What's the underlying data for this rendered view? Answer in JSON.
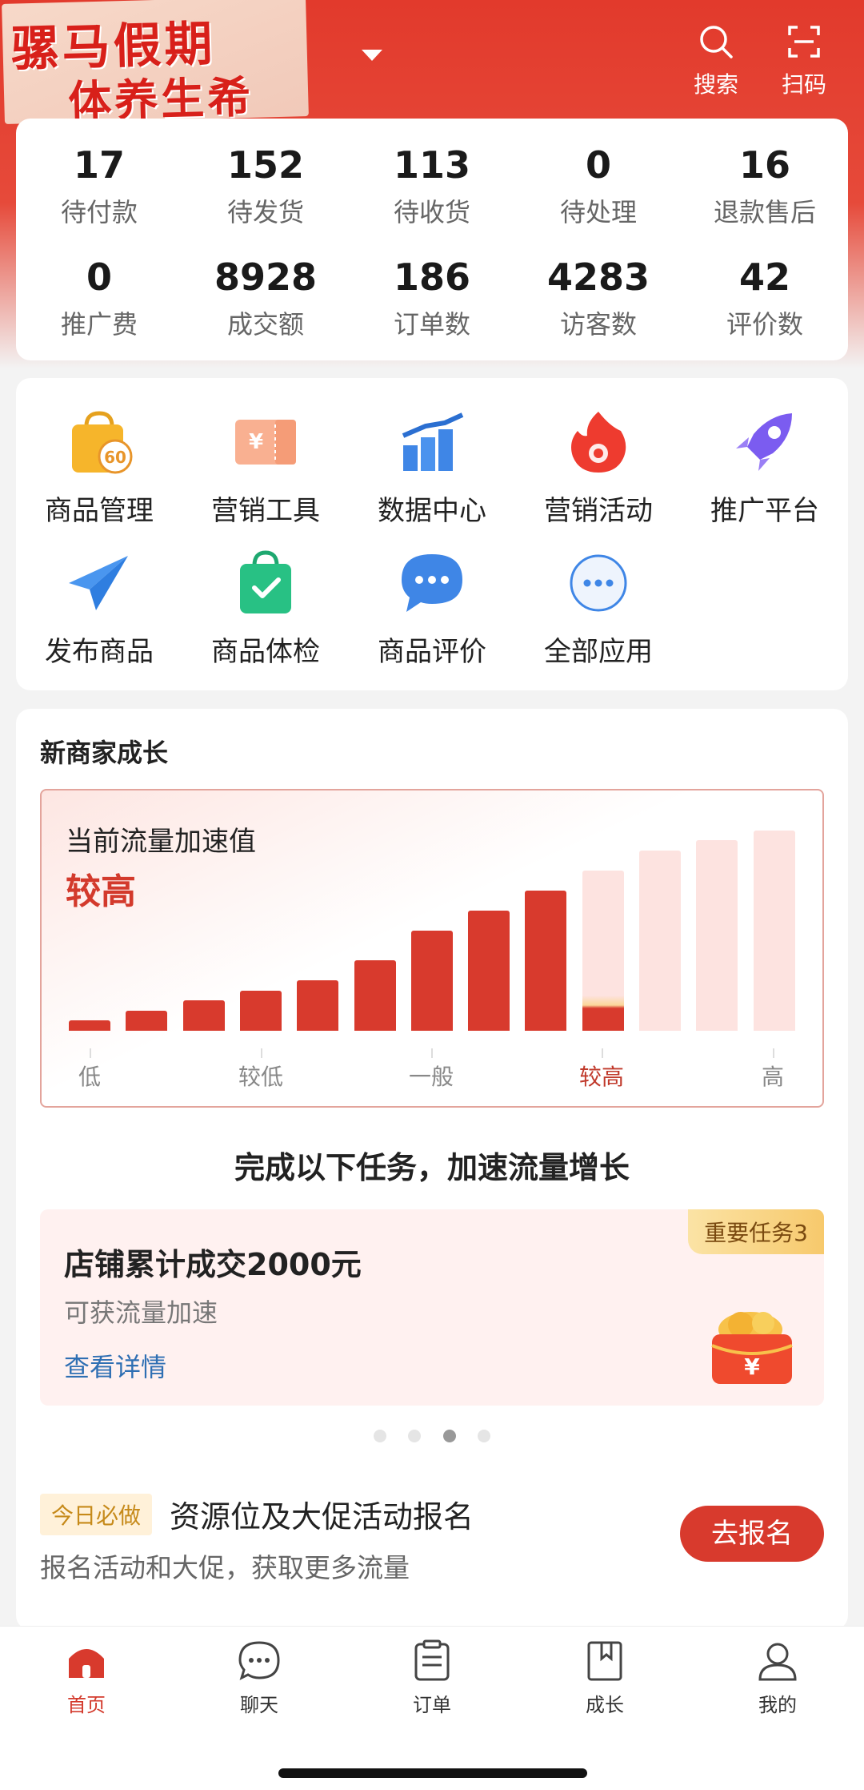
{
  "header": {
    "sticker_line1": "骡马假期",
    "sticker_line2": "体养生希",
    "search_label": "搜索",
    "scan_label": "扫码"
  },
  "stats": [
    {
      "value": "17",
      "label": "待付款"
    },
    {
      "value": "152",
      "label": "待发货"
    },
    {
      "value": "113",
      "label": "待收货"
    },
    {
      "value": "0",
      "label": "待处理"
    },
    {
      "value": "16",
      "label": "退款售后"
    },
    {
      "value": "0",
      "label": "推广费"
    },
    {
      "value": "8928",
      "label": "成交额"
    },
    {
      "value": "186",
      "label": "订单数"
    },
    {
      "value": "4283",
      "label": "访客数"
    },
    {
      "value": "42",
      "label": "评价数"
    }
  ],
  "apps": [
    {
      "label": "商品管理",
      "icon": "shopping-bag-60-icon",
      "badge": "60"
    },
    {
      "label": "营销工具",
      "icon": "coupon-icon"
    },
    {
      "label": "数据中心",
      "icon": "bar-chart-icon"
    },
    {
      "label": "营销活动",
      "icon": "flame-icon"
    },
    {
      "label": "推广平台",
      "icon": "rocket-icon"
    },
    {
      "label": "发布商品",
      "icon": "paper-plane-icon"
    },
    {
      "label": "商品体检",
      "icon": "check-bag-icon"
    },
    {
      "label": "商品评价",
      "icon": "chat-bubble-icon"
    },
    {
      "label": "全部应用",
      "icon": "more-dots-icon"
    }
  ],
  "growth": {
    "title": "新商家成长",
    "flow_label": "当前流量加速值",
    "flow_value": "较高",
    "levels": [
      "低",
      "较低",
      "一般",
      "较高",
      "高"
    ],
    "active_level": "较高",
    "task_heading": "完成以下任务，加速流量增长",
    "task": {
      "badge": "重要任务3",
      "title": "店铺累计成交2000元",
      "subtitle": "可获流量加速",
      "link": "查看详情"
    },
    "carousel": {
      "total": 4,
      "active_index": 2
    },
    "today": {
      "badge": "今日必做",
      "title": "资源位及大促活动报名",
      "subtitle": "报名活动和大促，获取更多流量",
      "button": "去报名"
    }
  },
  "chart_data": {
    "type": "bar",
    "title": "当前流量加速值",
    "categories": [
      "低",
      "",
      "",
      "较低",
      "",
      "",
      "一般",
      "",
      "",
      "较高",
      "",
      "",
      "高"
    ],
    "series": [
      {
        "values": [
          0.5,
          1,
          1.5,
          2,
          2.5,
          3.5,
          5,
          6,
          7,
          8,
          9,
          9.5,
          10
        ]
      }
    ],
    "filled_count": 10,
    "ylim": [
      0,
      10
    ],
    "colors": {
      "filled": "#d83a2d",
      "unfilled": "#fde3e0"
    }
  },
  "tabbar": [
    {
      "label": "首页",
      "icon": "home-icon",
      "active": true
    },
    {
      "label": "聊天",
      "icon": "chat-icon",
      "active": false
    },
    {
      "label": "订单",
      "icon": "order-clipboard-icon",
      "active": false
    },
    {
      "label": "成长",
      "icon": "growth-book-icon",
      "active": false
    },
    {
      "label": "我的",
      "icon": "profile-icon",
      "active": false
    }
  ],
  "colors": {
    "brand_red": "#e23a2c",
    "accent_red": "#d83a2d",
    "link_blue": "#2f6fb3"
  }
}
